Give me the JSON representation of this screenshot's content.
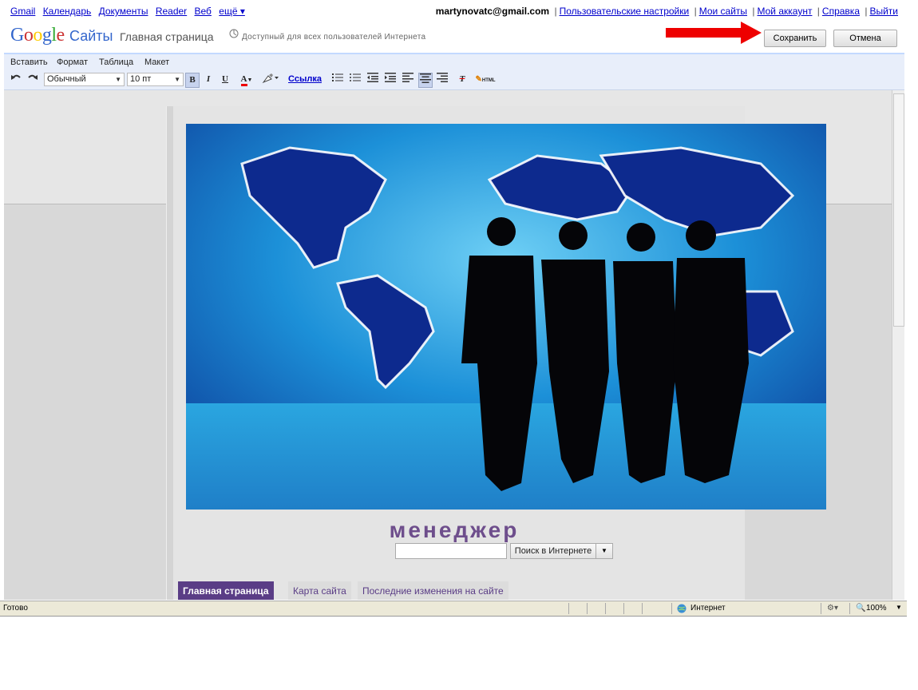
{
  "topbar": {
    "links": [
      "Gmail",
      "Календарь",
      "Документы",
      "Reader",
      "Веб",
      "ещё ▾"
    ],
    "email": "martynovatc@gmail.com",
    "account_links": [
      "Пользовательские настройки",
      "Мои сайты",
      "Мой аккаунт",
      "Справка",
      "Выйти"
    ]
  },
  "header": {
    "logo_letters": [
      "G",
      "o",
      "o",
      "g",
      "l",
      "e"
    ],
    "product": "Сайты",
    "page_title": "Главная страница",
    "access_text": "Доступный для всех пользователей Интернета",
    "save_label": "Сохранить",
    "cancel_label": "Отмена"
  },
  "menu": [
    "Вставить",
    "Формат",
    "Таблица",
    "Макет"
  ],
  "toolbar": {
    "style_value": "Обычный",
    "size_value": "10 пт",
    "bold": "B",
    "italic": "I",
    "underline": "U",
    "text_color": "A",
    "link_label": "Ссылка",
    "clear_format": "T",
    "html_label": "HTML"
  },
  "site": {
    "name": "менеджер",
    "search_button": "Поиск в Интернете",
    "nav": [
      "Главная страница",
      "Карта сайта",
      "Последние изменения на сайте"
    ]
  },
  "statusbar": {
    "status": "Готово",
    "zone": "Интернет",
    "zoom": "100%"
  },
  "colors": {
    "accent_red": "#ee0000",
    "nav_active": "#5a3d86",
    "site_name": "#6e4e8c"
  }
}
